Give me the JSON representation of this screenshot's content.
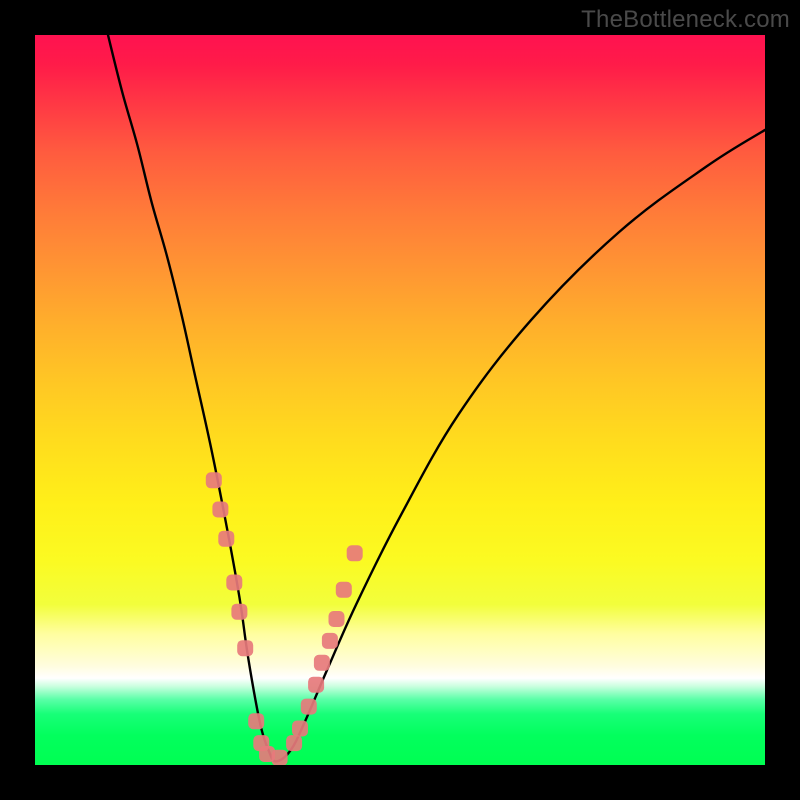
{
  "watermark": "TheBottleneck.com",
  "colors": {
    "frame": "#000000",
    "curve": "#000000",
    "marker_fill": "#e77a7c",
    "marker_stroke": "#e77a7c"
  },
  "chart_data": {
    "type": "line",
    "title": "",
    "xlabel": "",
    "ylabel": "",
    "xlim": [
      0,
      100
    ],
    "ylim": [
      0,
      100
    ],
    "grid": false,
    "note": "Axes have no visible tick labels; x is a normalized 0–100 hardware-balance axis, y is 0–100 bottleneck percentage (0 at bottom).",
    "series": [
      {
        "name": "bottleneck-curve",
        "x": [
          10,
          12,
          14,
          16,
          18,
          20,
          22,
          24,
          26,
          28,
          29,
          30,
          31,
          32,
          33,
          35,
          37,
          40,
          44,
          50,
          58,
          68,
          80,
          92,
          100
        ],
        "y": [
          100,
          92,
          85,
          77,
          70,
          62,
          53,
          44,
          34,
          23,
          16,
          10,
          5,
          2,
          0.5,
          2,
          6,
          13,
          22,
          34,
          48,
          61,
          73,
          82,
          87
        ]
      }
    ],
    "markers": {
      "name": "highlighted-points",
      "x": [
        24.5,
        25.4,
        26.2,
        27.3,
        28.0,
        28.8,
        30.3,
        31.0,
        31.8,
        33.5,
        35.5,
        36.3,
        37.5,
        38.5,
        39.3,
        40.4,
        41.3,
        42.3,
        43.8
      ],
      "y": [
        39,
        35,
        31,
        25,
        21,
        16,
        6,
        3,
        1.5,
        1,
        3,
        5,
        8,
        11,
        14,
        17,
        20,
        24,
        29
      ]
    },
    "gradient_stops": [
      {
        "pos": 0.0,
        "color": "#ff1250"
      },
      {
        "pos": 0.5,
        "color": "#ffd020"
      },
      {
        "pos": 0.86,
        "color": "#fffde0"
      },
      {
        "pos": 0.9,
        "color": "#8bffc0"
      },
      {
        "pos": 1.0,
        "color": "#00ff52"
      }
    ]
  }
}
